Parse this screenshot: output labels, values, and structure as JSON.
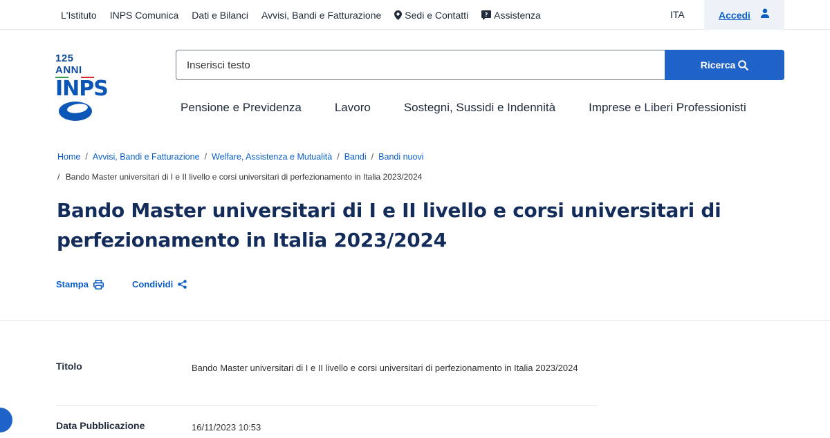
{
  "topbar": {
    "links": [
      "L'Istituto",
      "INPS Comunica",
      "Dati e Bilanci",
      "Avvisi, Bandi e Fatturazione",
      "Sedi e Contatti",
      "Assistenza"
    ],
    "icons": {
      "sedi": "map-pin-icon",
      "assistenza": "help-chat-icon"
    },
    "language": "ITA",
    "login_label": "Accedi"
  },
  "logo": {
    "anni": "125 ANNI",
    "name": "INPS",
    "flag_colors": [
      "#2e9d4a",
      "#ffffff",
      "#d9272d"
    ]
  },
  "search": {
    "placeholder": "Inserisci testo",
    "button_label": "Ricerca"
  },
  "mainnav": [
    "Pensione e Previdenza",
    "Lavoro",
    "Sostegni, Sussidi e Indennità",
    "Imprese e Liberi Professionisti"
  ],
  "breadcrumb": {
    "items": [
      "Home",
      "Avvisi, Bandi e Fatturazione",
      "Welfare, Assistenza e Mutualità",
      "Bandi",
      "Bandi nuovi"
    ],
    "current": "Bando Master universitari di I e II livello e corsi universitari di perfezionamento in Italia 2023/2024"
  },
  "page_title": "Bando Master universitari di I e II livello e corsi universitari di perfezionamento in Italia 2023/2024",
  "actions": {
    "print_label": "Stampa",
    "share_label": "Condividi"
  },
  "details": [
    {
      "label": "Titolo",
      "value": "Bando Master universitari di I e II livello e corsi universitari di perfezionamento in Italia 2023/2024"
    },
    {
      "label": "Data Pubblicazione",
      "value": "16/11/2023 10:53"
    }
  ],
  "colors": {
    "accent": "#1f63c9",
    "link": "#0b5fc7",
    "title": "#132c5a"
  }
}
